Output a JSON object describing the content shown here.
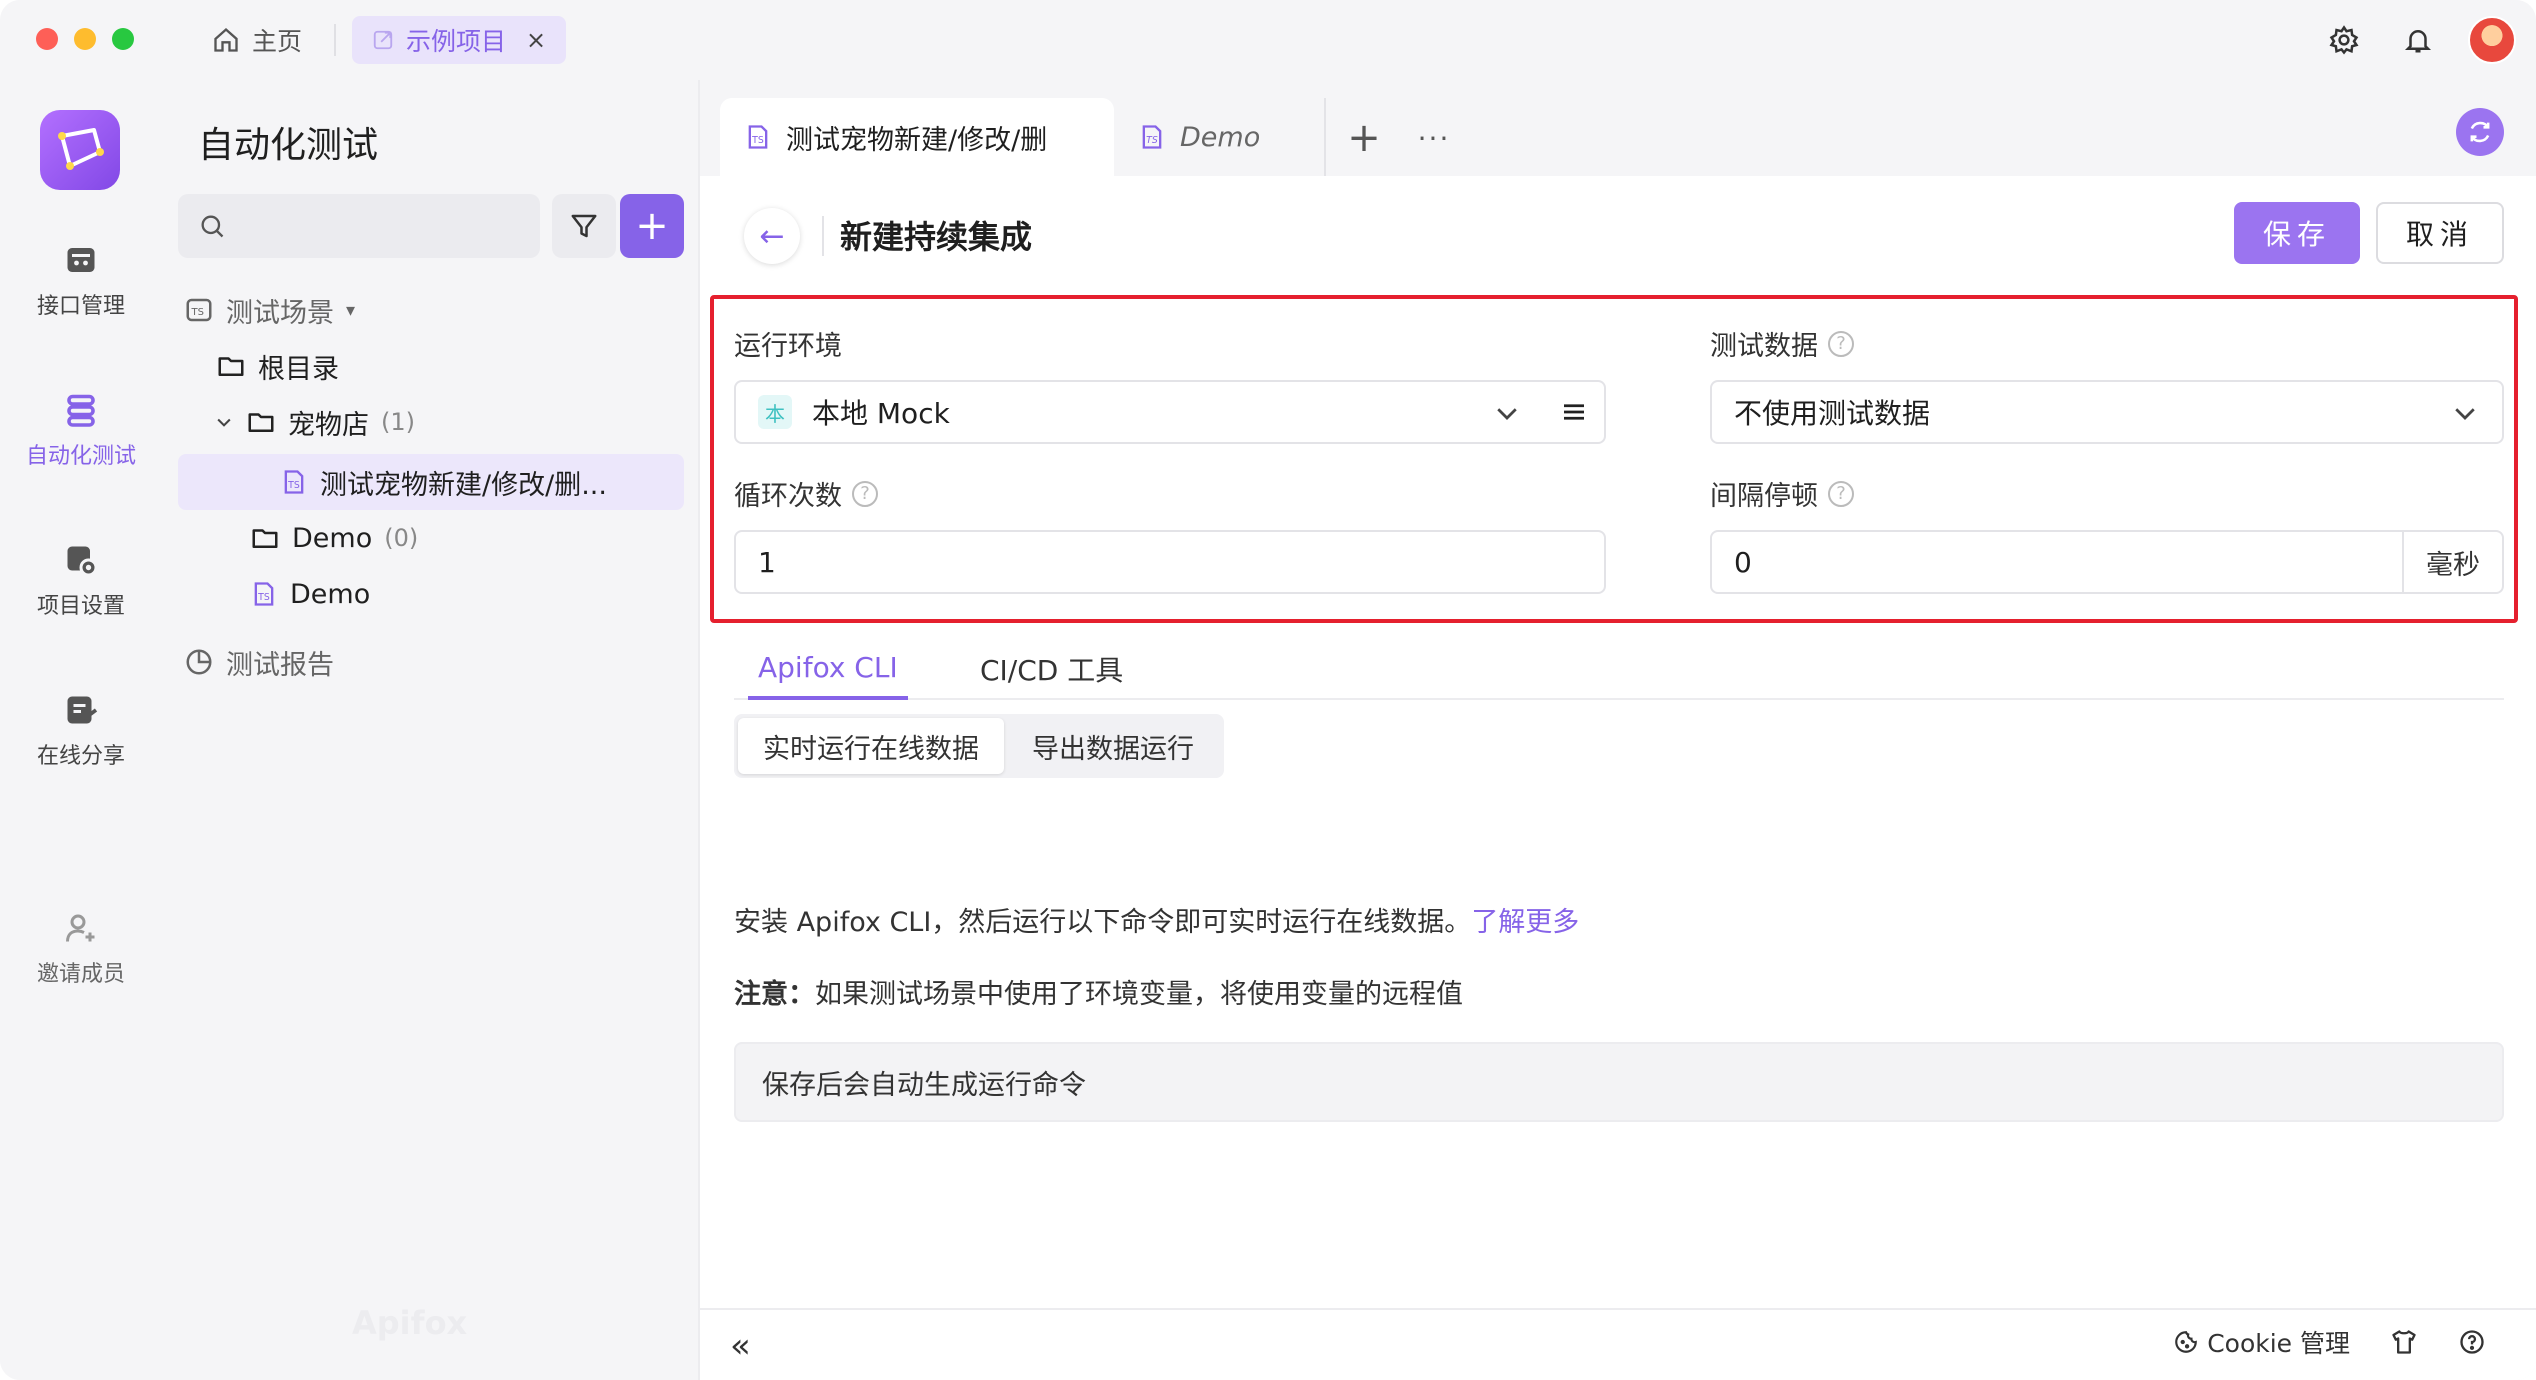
{
  "titlebar": {
    "home_label": "主页",
    "project_tab_label": "示例项目",
    "close_glyph": "×"
  },
  "leftnav": {
    "items": [
      {
        "label": "接口管理",
        "icon": "api-icon"
      },
      {
        "label": "自动化测试",
        "icon": "automation-icon"
      },
      {
        "label": "项目设置",
        "icon": "project-settings-icon"
      },
      {
        "label": "在线分享",
        "icon": "share-icon"
      },
      {
        "label": "邀请成员",
        "icon": "invite-member-icon"
      }
    ]
  },
  "tree": {
    "title": "自动化测试",
    "search_placeholder": "",
    "add_glyph": "+",
    "section_scenes": "测试场景",
    "root_folder": "根目录",
    "folder_petshop": "宠物店",
    "folder_petshop_count": "(1)",
    "scene_petshop": "测试宠物新建/修改/删...",
    "folder_demo": "Demo",
    "folder_demo_count": "(0)",
    "scene_demo": "Demo",
    "section_reports": "测试报告",
    "watermark": "Apifox"
  },
  "tabs": {
    "active_label": "测试宠物新建/修改/删",
    "other_label": "Demo",
    "plus_glyph": "+",
    "more_glyph": "···"
  },
  "page": {
    "back_glyph": "←",
    "title": "新建持续集成",
    "save_label": "保存",
    "cancel_label": "取消"
  },
  "form": {
    "env_label": "运行环境",
    "env_badge": "本",
    "env_value": "本地 Mock",
    "data_label": "测试数据",
    "data_value": "不使用测试数据",
    "loop_label": "循环次数",
    "loop_value": "1",
    "interval_label": "间隔停顿",
    "interval_value": "0",
    "interval_unit": "毫秒",
    "help_glyph": "?"
  },
  "subtabs": {
    "cli_label": "Apifox CLI",
    "cicd_label": "CI/CD 工具"
  },
  "segment": {
    "online_label": "实时运行在线数据",
    "export_label": "导出数据运行"
  },
  "content": {
    "desc_text": "安装 Apifox CLI，然后运行以下命令即可实时运行在线数据。",
    "learn_more": "了解更多",
    "note_prefix": "注意：",
    "note_text": "如果测试场景中使用了环境变量，将使用变量的远程值",
    "cmd_placeholder": "保存后会自动生成运行命令"
  },
  "footer": {
    "collapse_glyph": "«",
    "cookie_label": "Cookie 管理"
  }
}
